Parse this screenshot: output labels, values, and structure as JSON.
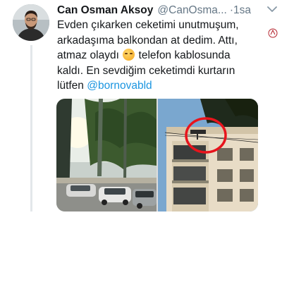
{
  "tweet": {
    "display_name": "Can Osman Aksoy",
    "handle": "@CanOsma...",
    "separator": "·",
    "time": "1sa",
    "text_line_1": "Evden çıkarken ceketimi unutmuşum,",
    "text_line_2": "arkadaşıma balkondan at dedim. Attı,",
    "text_line_3a": "atmaz olaydı",
    "text_line_3b": "telefon kablosunda",
    "text_line_4": "kaldı. En sevdiğim ceketimdi kurtarın",
    "text_line_5a": "lütfen",
    "mention": "@bornovabld"
  },
  "icons": {
    "avatar": "user-avatar",
    "emoji": "pensive-face-emoji",
    "menu": "chevron-down-icon",
    "corner_logo": "logo-mark"
  },
  "media": {
    "photos": [
      "street-trees-cars-photo",
      "apartment-balcony-photo"
    ],
    "highlight_color": "#e8141c"
  },
  "colors": {
    "text": "#14171a",
    "secondary": "#657786",
    "link": "#1b95e0",
    "thread_line": "#e3e7ea"
  }
}
